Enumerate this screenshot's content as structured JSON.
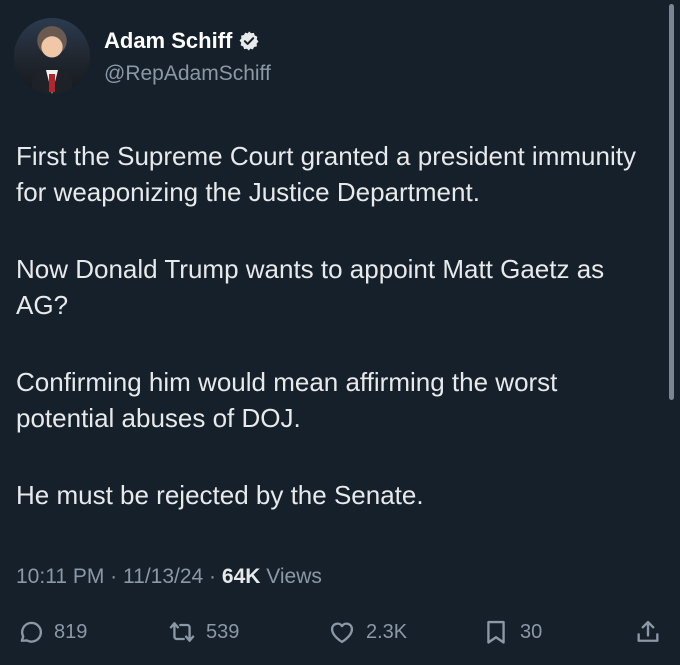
{
  "author": {
    "display_name": "Adam Schiff",
    "handle": "@RepAdamSchiff",
    "verified_icon": "verified-badge-icon"
  },
  "tweet": {
    "paragraphs": [
      "First the Supreme Court granted a president immunity for weaponizing the Justice Department.",
      "Now Donald Trump wants to appoint Matt Gaetz as AG?",
      "Confirming him would mean affirming the worst potential abuses of DOJ.",
      "He must be rejected by the Senate."
    ]
  },
  "meta": {
    "time": "10:11 PM",
    "separator": "·",
    "date": "11/13/24",
    "views_count": "64K",
    "views_label": "Views"
  },
  "actions": {
    "replies": "819",
    "retweets": "539",
    "likes": "2.3K",
    "bookmarks": "30"
  },
  "colors": {
    "background": "#15202b",
    "text": "#e7e9ea",
    "muted": "#8b98a5"
  }
}
